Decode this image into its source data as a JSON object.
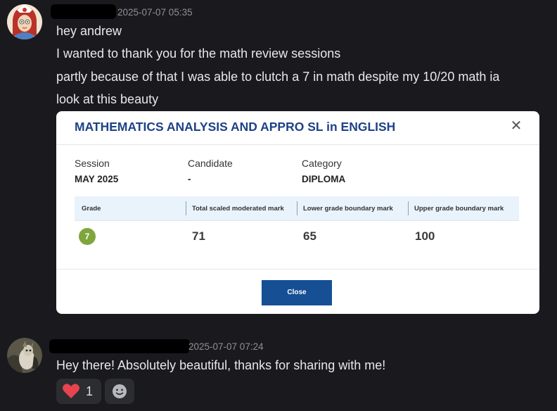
{
  "colors": {
    "background": "#1a1a1e",
    "message_text": "#e7e8ea",
    "timestamp": "#8e9096",
    "card_title": "#1d4288",
    "grade_badge": "#7ea63c",
    "close_button": "#164f94",
    "table_header_bg": "#e9f3fc",
    "heart": "#e8434f"
  },
  "message1": {
    "timestamp": "2025-07-07 05:35",
    "lines": [
      "hey andrew",
      "I wanted to thank you for the math review sessions",
      "partly because of that I was able to clutch a 7 in math despite my 10/20 math ia",
      "look at this beauty"
    ]
  },
  "result_card": {
    "title": "MATHEMATICS ANALYSIS AND APPRO SL in ENGLISH",
    "close_icon": "close-icon",
    "session_label": "Session",
    "session_value": "MAY 2025",
    "candidate_label": "Candidate",
    "candidate_value": "-",
    "category_label": "Category",
    "category_value": "DIPLOMA",
    "columns": [
      "Grade",
      "Total scaled moderated mark",
      "Lower grade boundary mark",
      "Upper grade boundary mark"
    ],
    "grade": "7",
    "total_mark": "71",
    "lower_boundary": "65",
    "upper_boundary": "100",
    "close_button_label": "Close"
  },
  "message2": {
    "timestamp": "2025-07-07 07:24",
    "text": "Hey there! Absolutely beautiful, thanks for sharing with me!",
    "reactions": [
      {
        "icon": "heart-icon",
        "count": "1"
      },
      {
        "icon": "add-reaction-icon"
      }
    ]
  }
}
